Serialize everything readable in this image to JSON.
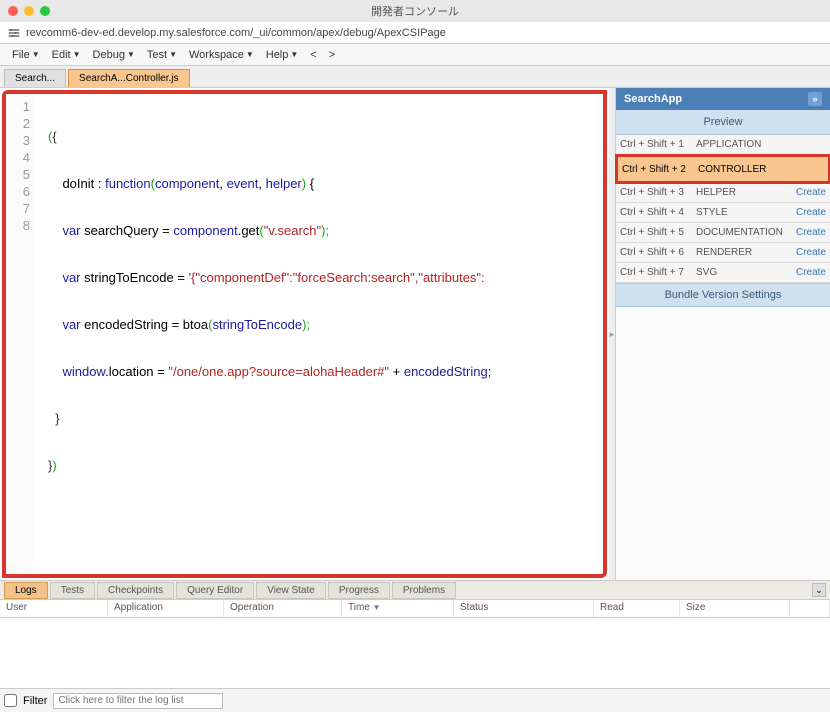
{
  "window": {
    "title": "開発者コンソール"
  },
  "url": "revcomm6-dev-ed.develop.my.salesforce.com/_ui/common/apex/debug/ApexCSIPage",
  "menu": {
    "items": [
      "File",
      "Edit",
      "Debug",
      "Test",
      "Workspace",
      "Help"
    ],
    "nav_prev": "<",
    "nav_next": ">"
  },
  "file_tabs": {
    "items": [
      {
        "label": "Search...",
        "active": false
      },
      {
        "label": "SearchA...Controller.js",
        "active": true
      }
    ]
  },
  "gutter": [
    "1",
    "2",
    "3",
    "4",
    "5",
    "6",
    "7",
    "8"
  ],
  "code": {
    "l1_paren": "(",
    "l1_brace": "{",
    "l2_key": "doInit",
    "l2_colon": " : ",
    "l2_func": "function",
    "l2_args_open": "(",
    "l2_arg1": "component",
    "l2_comma1": ", ",
    "l2_arg2": "event",
    "l2_comma2": ", ",
    "l2_arg3": "helper",
    "l2_args_close": ")",
    "l2_brace": " {",
    "l3_kw": "var",
    "l3_var": " searchQuery = ",
    "l3_obj": "component",
    "l3_dot": ".",
    "l3_method": "get",
    "l3_open": "(",
    "l3_str": "\"v.search\"",
    "l3_close": ");",
    "l4_kw": "var",
    "l4_var": " stringToEncode = ",
    "l4_str": "'{\"componentDef\":\"forceSearch:search\",\"attributes\":",
    "l5_kw": "var",
    "l5_var": " encodedString = ",
    "l5_fn": "btoa",
    "l5_open": "(",
    "l5_arg": "stringToEncode",
    "l5_close": ");",
    "l6_obj": "window",
    "l6_dot": ".",
    "l6_prop": "location",
    "l6_eq": " = ",
    "l6_str": "\"/one/one.app?source=alohaHeader#\"",
    "l6_plus": " + ",
    "l6_var": "encodedString",
    "l6_semi": ";",
    "l7_brace": "}",
    "l8_brace": "}",
    "l8_paren": ")"
  },
  "side": {
    "header": "SearchApp",
    "preview": "Preview",
    "rows": [
      {
        "shortcut": "Ctrl + Shift + 1",
        "label": "APPLICATION",
        "action": ""
      },
      {
        "shortcut": "Ctrl + Shift + 2",
        "label": "CONTROLLER",
        "action": "",
        "highlight": true
      },
      {
        "shortcut": "Ctrl + Shift + 3",
        "label": "HELPER",
        "action": "Create"
      },
      {
        "shortcut": "Ctrl + Shift + 4",
        "label": "STYLE",
        "action": "Create"
      },
      {
        "shortcut": "Ctrl + Shift + 5",
        "label": "DOCUMENTATION",
        "action": "Create"
      },
      {
        "shortcut": "Ctrl + Shift + 6",
        "label": "RENDERER",
        "action": "Create"
      },
      {
        "shortcut": "Ctrl + Shift + 7",
        "label": "SVG",
        "action": "Create"
      }
    ],
    "footer": "Bundle Version Settings"
  },
  "bottom_tabs": [
    "Logs",
    "Tests",
    "Checkpoints",
    "Query Editor",
    "View State",
    "Progress",
    "Problems"
  ],
  "log_header": {
    "user": "User",
    "application": "Application",
    "operation": "Operation",
    "time": "Time",
    "status": "Status",
    "read": "Read",
    "size": "Size"
  },
  "log_footer": {
    "filter_label": "Filter",
    "filter_placeholder": "Click here to filter the log list"
  }
}
